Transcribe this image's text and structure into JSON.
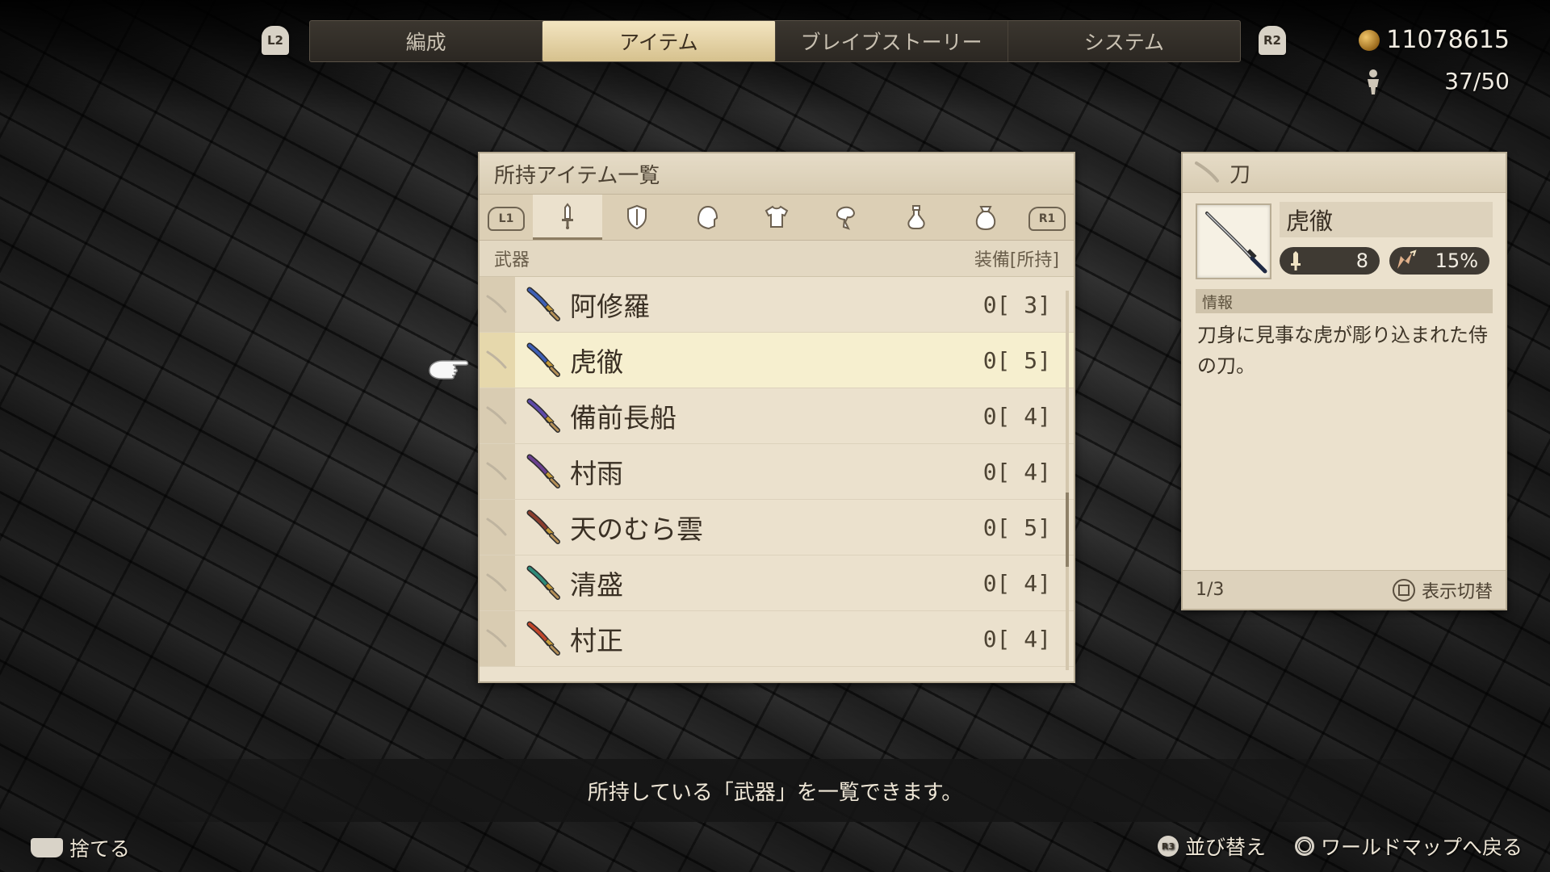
{
  "header": {
    "left_shoulder": "L2",
    "right_shoulder": "R2",
    "tabs": [
      {
        "label": "編成",
        "active": false
      },
      {
        "label": "アイテム",
        "active": true
      },
      {
        "label": "ブレイブストーリー",
        "active": false
      },
      {
        "label": "システム",
        "active": false
      }
    ],
    "gil": "11078615",
    "party": "37/50"
  },
  "list_panel": {
    "title": "所持アイテム一覧",
    "left_bumper": "L1",
    "right_bumper": "R1",
    "categories": [
      "sword",
      "shield",
      "helmet",
      "armor",
      "accessory",
      "potion",
      "bag"
    ],
    "active_category": "sword",
    "section_label": "武器",
    "column_label": "装備[所持]",
    "items": [
      {
        "name": "阿修羅",
        "count": "0[ 3]",
        "blade_color": "#3e5fb5"
      },
      {
        "name": "虎徹",
        "count": "0[ 5]",
        "blade_color": "#3e5fb5"
      },
      {
        "name": "備前長船",
        "count": "0[ 4]",
        "blade_color": "#5d4aa8"
      },
      {
        "name": "村雨",
        "count": "0[ 4]",
        "blade_color": "#6a3f8f"
      },
      {
        "name": "天のむら雲",
        "count": "0[ 5]",
        "blade_color": "#8a3c2c"
      },
      {
        "name": "清盛",
        "count": "0[ 4]",
        "blade_color": "#2f8a78"
      },
      {
        "name": "村正",
        "count": "0[ 4]",
        "blade_color": "#c0452a"
      }
    ],
    "selected_index": 1
  },
  "detail_panel": {
    "category": "刀",
    "name": "虎徹",
    "attack": "8",
    "evade": "15%",
    "info_label": "情報",
    "description": "刀身に見事な虎が彫り込まれた侍の刀。",
    "page": "1/3",
    "toggle_label": "表示切替"
  },
  "help_text": "所持している「武器」を一覧できます。",
  "hints": {
    "discard": "捨てる",
    "sort_button": "R3",
    "sort": "並び替え",
    "back": "ワールドマップへ戻る"
  },
  "colors": {
    "active_tab": "#e5d3a5",
    "panel_bg": "#ebe1cd",
    "selected_row": "#f6efcf"
  }
}
